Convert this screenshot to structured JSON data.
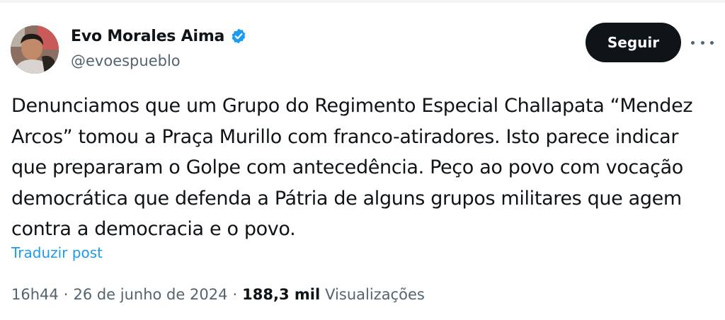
{
  "author": {
    "display_name": "Evo Morales Aima",
    "handle": "@evoespueblo",
    "verified": true,
    "avatar_icon": "profile-photo"
  },
  "actions": {
    "follow_label": "Seguir",
    "more_icon": "more-horizontal-icon"
  },
  "post": {
    "lines": [
      "Denunciamos que um Grupo do Regimento Especial Challapata “Mendez",
      "Arcos” tomou a Praça Murillo com franco-atiradores. Isto parece indicar",
      "que prepararam o Golpe com antecedência. Peço ao povo com vocação",
      "democrática que defenda a Pátria de alguns grupos militares que agem",
      "contra a democracia e o povo."
    ],
    "translate_label": "Traduzir post"
  },
  "meta": {
    "time": "16h44",
    "separator": "·",
    "date": "26 de junho de 2024",
    "views_count": "188,3 mil",
    "views_label": "Visualizações"
  },
  "colors": {
    "accent": "#1d9bf0",
    "text": "#0f1419",
    "secondary": "#536471",
    "button_bg": "#0f1419"
  }
}
